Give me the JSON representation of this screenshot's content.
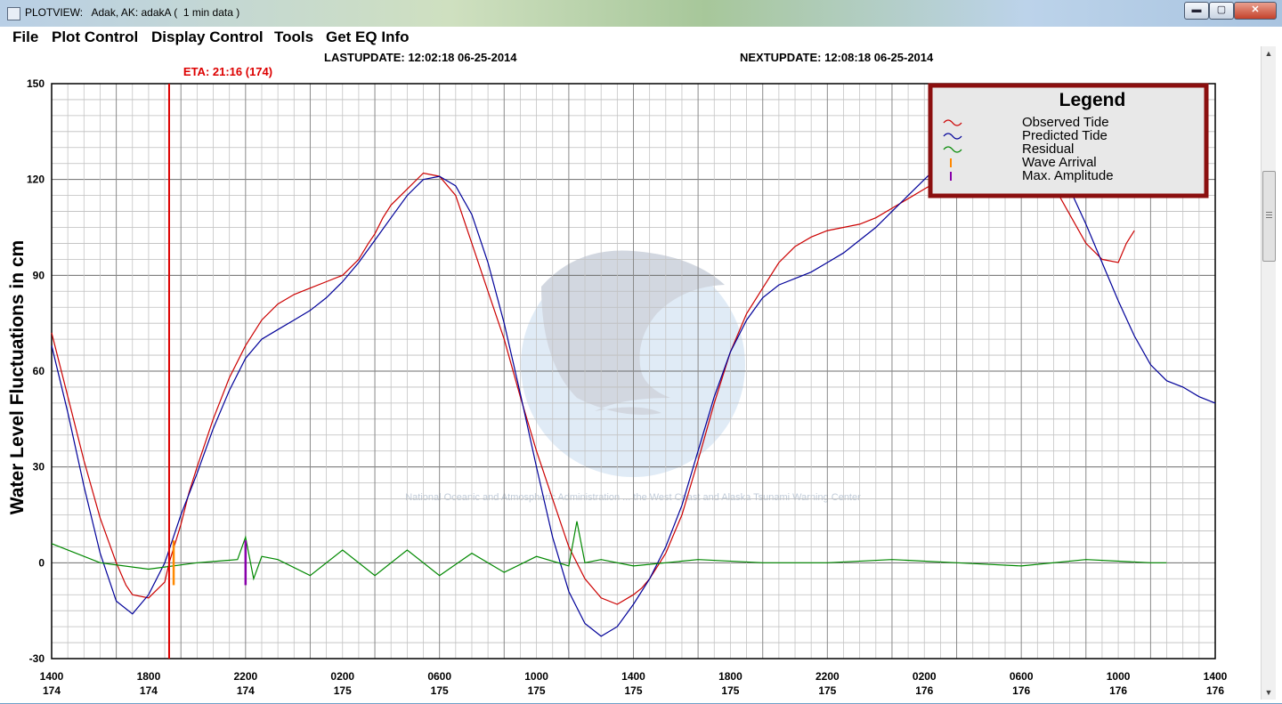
{
  "window": {
    "title": "PLOTVIEW:   Adak, AK: adakA (  1 min data )",
    "minimize_glyph": "▬",
    "maximize_glyph": "▢",
    "close_glyph": "✕"
  },
  "menu": {
    "items": [
      "File",
      "Plot Control",
      "Display Control",
      "Tools",
      "Get EQ Info"
    ]
  },
  "header": {
    "last_update": "LASTUPDATE: 12:02:18 06-25-2014",
    "next_update": "NEXTUPDATE: 12:08:18 06-25-2014",
    "eta_label": "ETA: 21:16 (174)"
  },
  "legend": {
    "title": "Legend",
    "items": [
      {
        "label": "Observed Tide",
        "color": "#cc0000",
        "symbol": "wave"
      },
      {
        "label": "Predicted Tide",
        "color": "#000099",
        "symbol": "wave"
      },
      {
        "label": "Residual",
        "color": "#008800",
        "symbol": "wave"
      },
      {
        "label": "Wave Arrival",
        "color": "#ff8800",
        "symbol": "bar"
      },
      {
        "label": "Max. Amplitude",
        "color": "#8800aa",
        "symbol": "bar"
      }
    ]
  },
  "watermark": {
    "text": "National Oceanic and Atmospheric Administration ... the West Coast and Alaska Tsunami Warning Center"
  },
  "colors": {
    "observed": "#cc0000",
    "predicted": "#000099",
    "residual": "#008800",
    "wave_arrival": "#ff8800",
    "max_amplitude": "#8800aa",
    "eta_line": "#dd0000",
    "legend_border": "#8b0f0f"
  },
  "chart_data": {
    "type": "line",
    "title": "",
    "xlabel": "",
    "ylabel": "Water Level Fluctuations in cm",
    "ylim": [
      -30,
      150
    ],
    "yticks": [
      -30,
      0,
      30,
      60,
      90,
      120,
      150
    ],
    "xlim_hours": [
      0,
      72
    ],
    "xticks": [
      {
        "time": "1400",
        "day": "174"
      },
      {
        "time": "1800",
        "day": "174"
      },
      {
        "time": "2200",
        "day": "174"
      },
      {
        "time": "0200",
        "day": "175"
      },
      {
        "time": "0600",
        "day": "175"
      },
      {
        "time": "1000",
        "day": "175"
      },
      {
        "time": "1400",
        "day": "175"
      },
      {
        "time": "1800",
        "day": "175"
      },
      {
        "time": "2200",
        "day": "175"
      },
      {
        "time": "0200",
        "day": "176"
      },
      {
        "time": "0600",
        "day": "176"
      },
      {
        "time": "1000",
        "day": "176"
      },
      {
        "time": "1400",
        "day": "176"
      }
    ],
    "grid": true,
    "legend_position": "top-right",
    "series": [
      {
        "name": "Observed Tide",
        "x": [
          0,
          1,
          2,
          3,
          4,
          4.6,
          5,
          6,
          7,
          7.27,
          8,
          8.5,
          9,
          10,
          11,
          12,
          13,
          14,
          15,
          16,
          17,
          18,
          19,
          19.6,
          20,
          20.5,
          21,
          22,
          23,
          24,
          25,
          26,
          27,
          28,
          29,
          30,
          31,
          32,
          33,
          34,
          35,
          36,
          36.5,
          37,
          38,
          39,
          40,
          41,
          42,
          43,
          44,
          45,
          46,
          47,
          48,
          49,
          50,
          51,
          52,
          53,
          54,
          55,
          56,
          57,
          58,
          59,
          60,
          61,
          62,
          63,
          64,
          65,
          66,
          66.5,
          67
        ],
        "values": [
          72,
          52,
          32,
          14,
          0,
          -7,
          -10,
          -11,
          -6,
          0,
          12,
          22,
          30,
          45,
          58,
          68,
          76,
          81,
          84,
          86,
          88,
          90,
          95,
          100,
          103,
          108,
          112,
          117,
          122,
          121,
          115,
          100,
          85,
          70,
          52,
          35,
          20,
          5,
          -5,
          -11,
          -13,
          -10,
          -8,
          -5,
          3,
          15,
          32,
          50,
          66,
          78,
          86,
          94,
          99,
          102,
          104,
          105,
          106,
          108,
          111,
          114,
          117,
          120,
          124,
          126,
          128,
          129,
          128,
          124,
          118,
          109,
          100,
          95,
          94,
          100,
          104
        ]
      },
      {
        "name": "Predicted Tide",
        "x": [
          0,
          1,
          2,
          3,
          4,
          5,
          6,
          7,
          8,
          9,
          10,
          11,
          12,
          13,
          14,
          15,
          16,
          17,
          18,
          19,
          20,
          21,
          22,
          23,
          24,
          25,
          26,
          27,
          28,
          29,
          30,
          31,
          32,
          33,
          34,
          35,
          36,
          37,
          38,
          39,
          40,
          41,
          42,
          43,
          44,
          45,
          46,
          47,
          48,
          49,
          50,
          51,
          52,
          53,
          54,
          55,
          56,
          57,
          58,
          59,
          60,
          61,
          62,
          63,
          64,
          65,
          66,
          67,
          68,
          69,
          70,
          71,
          72
        ],
        "values": [
          68,
          47,
          24,
          3,
          -12,
          -16,
          -10,
          0,
          15,
          28,
          42,
          54,
          64,
          70,
          73,
          76,
          79,
          83,
          88,
          94,
          101,
          108,
          115,
          120,
          121,
          118,
          109,
          94,
          75,
          53,
          30,
          8,
          -9,
          -19,
          -23,
          -20,
          -13,
          -5,
          5,
          18,
          35,
          52,
          66,
          76,
          83,
          87,
          89,
          91,
          94,
          97,
          101,
          105,
          110,
          115,
          120,
          125,
          130,
          134,
          137,
          138,
          137,
          133,
          126,
          117,
          106,
          94,
          82,
          71,
          62,
          57,
          55,
          52,
          50
        ]
      },
      {
        "name": "Residual",
        "x": [
          0,
          3,
          6,
          9,
          11.5,
          12,
          12.5,
          13,
          14,
          16,
          18,
          20,
          22,
          24,
          26,
          28,
          30,
          32,
          32.5,
          33,
          34,
          36,
          40,
          44,
          48,
          52,
          56,
          60,
          64,
          68,
          69
        ],
        "values": [
          6,
          0,
          -2,
          0,
          1,
          8,
          -5,
          2,
          1,
          -4,
          4,
          -4,
          4,
          -4,
          3,
          -3,
          2,
          -1,
          13,
          0,
          1,
          -1,
          1,
          0,
          0,
          1,
          0,
          -1,
          1,
          0,
          0
        ]
      }
    ],
    "annotations": [
      {
        "label": "ETA: 21:16 (174)",
        "x_hours": 7.27,
        "type": "vertical-line"
      },
      {
        "label": "Wave Arrival",
        "x_hours": 7.55,
        "y_range": [
          -7,
          7
        ]
      },
      {
        "label": "Max. Amplitude",
        "x_hours": 12.0,
        "y_range": [
          -7,
          7
        ]
      }
    ]
  }
}
